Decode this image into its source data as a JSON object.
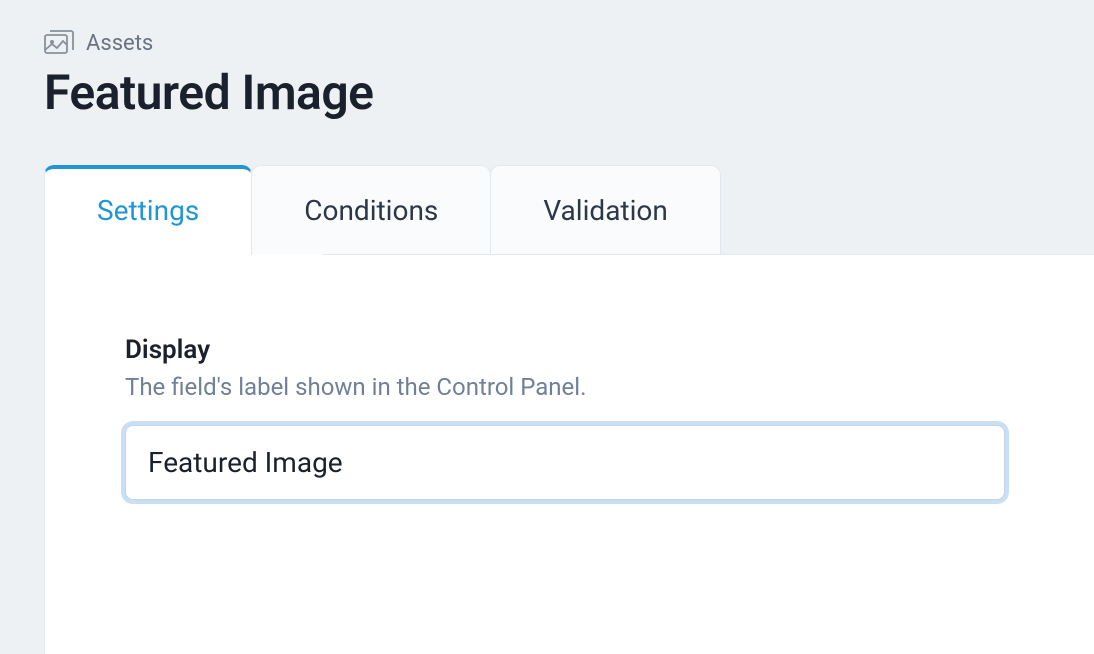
{
  "header": {
    "breadcrumb": "Assets",
    "title": "Featured Image"
  },
  "tabs": [
    {
      "label": "Settings",
      "active": true
    },
    {
      "label": "Conditions",
      "active": false
    },
    {
      "label": "Validation",
      "active": false
    }
  ],
  "fields": {
    "display": {
      "label": "Display",
      "help": "The field's label shown in the Control Panel.",
      "value": "Featured Image"
    }
  }
}
